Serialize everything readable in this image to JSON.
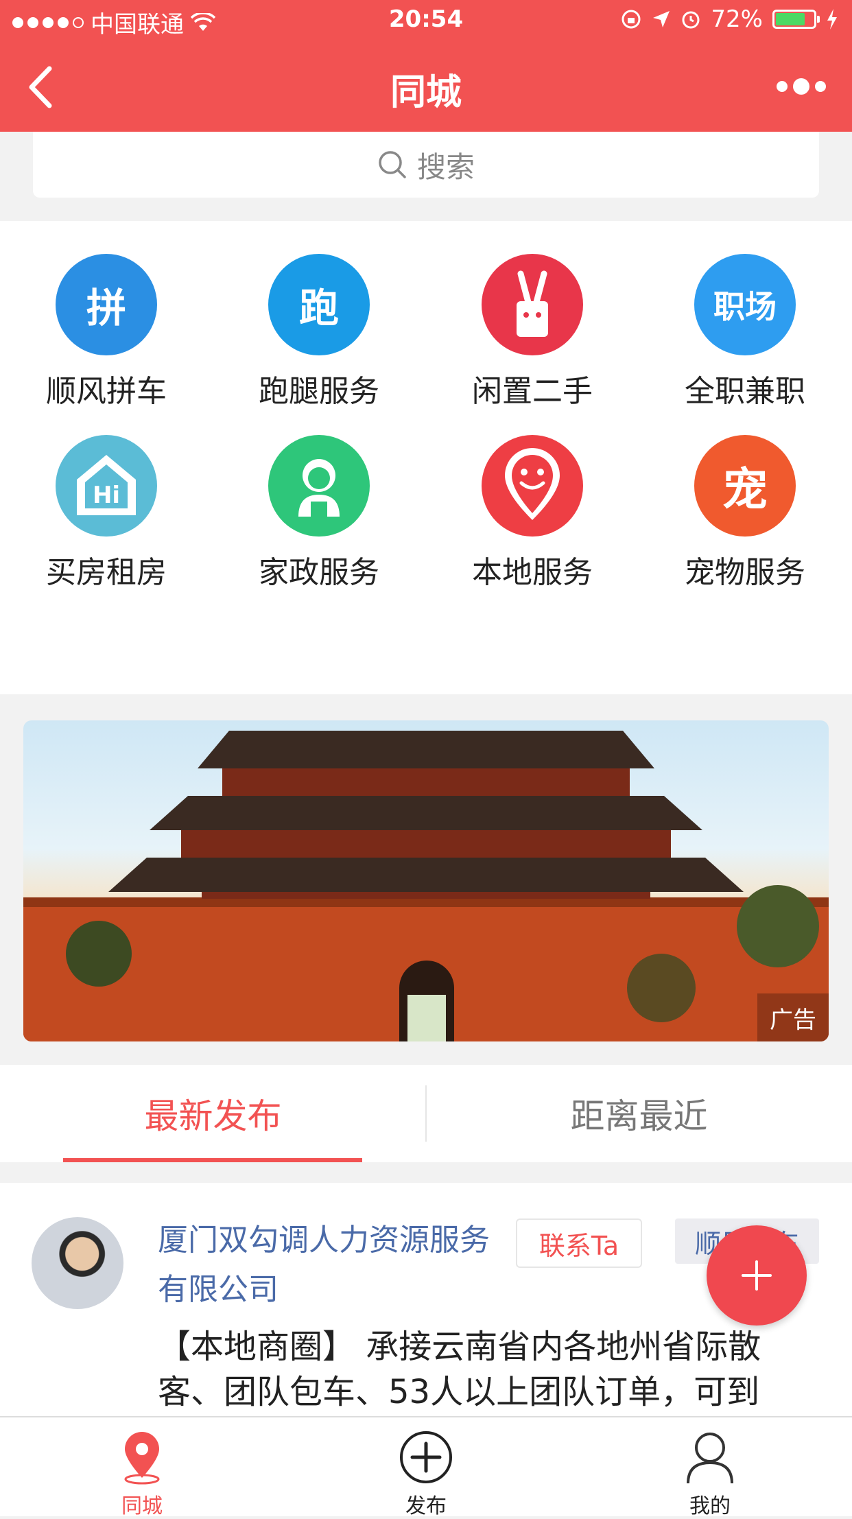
{
  "status_bar": {
    "carrier": "中国联通",
    "time": "20:54",
    "battery": "72%"
  },
  "nav": {
    "title": "同城"
  },
  "search": {
    "placeholder": "搜索"
  },
  "categories": [
    {
      "label": "顺风拼车",
      "icon": "carpool-icon",
      "glyph": "拼",
      "color": "#2b8fe3"
    },
    {
      "label": "跑腿服务",
      "icon": "errand-icon",
      "glyph": "跑",
      "color": "#1a9be6"
    },
    {
      "label": "闲置二手",
      "icon": "secondhand-icon",
      "glyph": "V",
      "color": "#e8364a"
    },
    {
      "label": "全职兼职",
      "icon": "job-icon",
      "glyph": "职场",
      "color": "#2e9df0"
    },
    {
      "label": "买房租房",
      "icon": "house-icon",
      "glyph": "Hi",
      "color": "#5bbcd6"
    },
    {
      "label": "家政服务",
      "icon": "housekeeping-icon",
      "glyph": "",
      "color": "#2ec67a"
    },
    {
      "label": "本地服务",
      "icon": "local-service-icon",
      "glyph": "",
      "color": "#ee3e44"
    },
    {
      "label": "宠物服务",
      "icon": "pet-icon",
      "glyph": "宠",
      "color": "#f05a2e"
    }
  ],
  "banner": {
    "ad_label": "广告"
  },
  "tabs": {
    "latest": "最新发布",
    "nearest": "距离最近"
  },
  "post": {
    "author": "厦门双勾调人力资源服务有限公司",
    "contact_label": "联系Ta",
    "category_tag": "顺风拼车",
    "text": "【本地商圈】 承接云南省内各地州省际散客、团队包车、53人以上团队订单，可到"
  },
  "tabbar": {
    "home": "同城",
    "publish": "发布",
    "mine": "我的"
  },
  "colors": {
    "brand": "#f25252"
  }
}
